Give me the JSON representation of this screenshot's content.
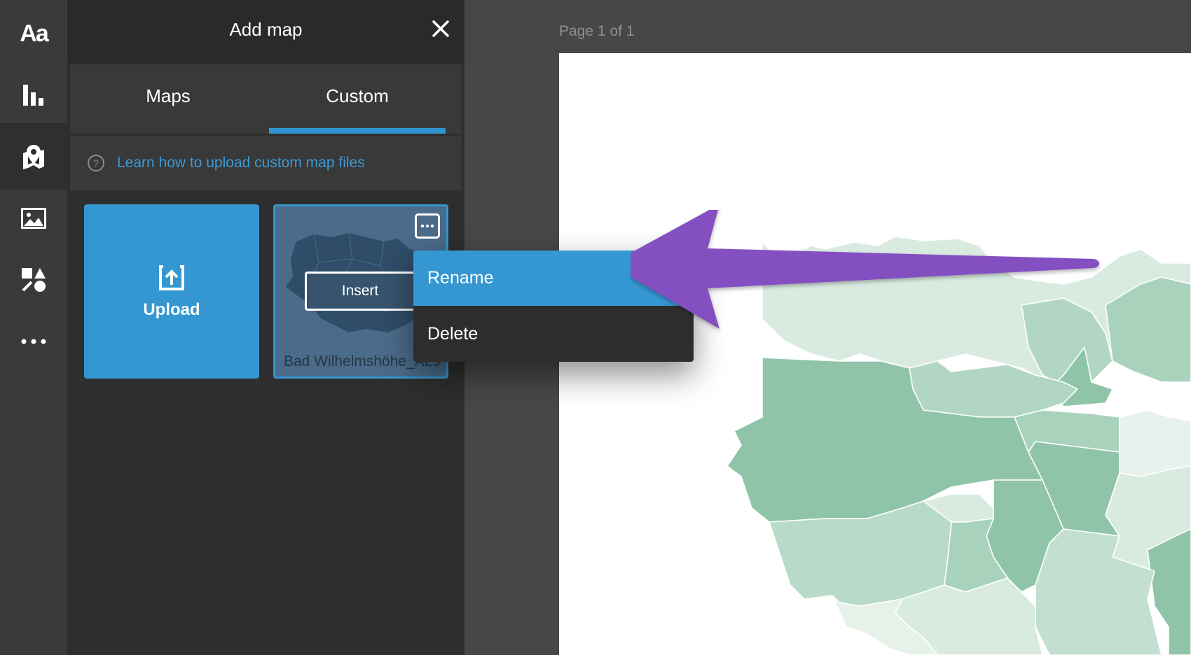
{
  "rail": {
    "items": [
      {
        "name": "text-icon",
        "label": "Aa"
      },
      {
        "name": "bar-chart-icon"
      },
      {
        "name": "map-pin-icon"
      },
      {
        "name": "image-icon"
      },
      {
        "name": "shapes-icon"
      },
      {
        "name": "more-icon"
      }
    ],
    "active_item": "map-pin-icon"
  },
  "panel": {
    "title": "Add map",
    "tabs": [
      {
        "label": "Maps",
        "active": false
      },
      {
        "label": "Custom",
        "active": true
      }
    ],
    "help_link": "Learn how to upload custom map files",
    "upload_label": "Upload",
    "map_tile": {
      "name": "Bad Wilhelmshöhe_AL9",
      "insert_label": "Insert"
    }
  },
  "context_menu": {
    "items": [
      {
        "label": "Rename",
        "highlighted": true
      },
      {
        "label": "Delete",
        "highlighted": false
      }
    ]
  },
  "canvas": {
    "page_indicator": "Page 1 of 1"
  },
  "colors": {
    "accent": "#3597d1",
    "arrow": "#8450c0",
    "link": "#3a99d6",
    "map_light": "#d9ebe1",
    "map_mid": "#b1d6c3",
    "map_dark": "#8fc4a8"
  }
}
